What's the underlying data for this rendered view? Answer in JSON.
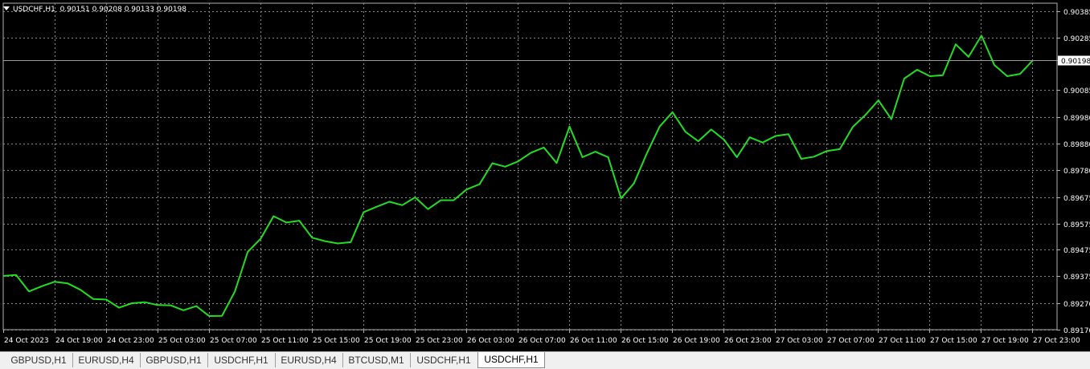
{
  "header": {
    "symbol": "USDCHF,H1",
    "ohlc": "0.90151 0.90208 0.90133 0.90198"
  },
  "current_price": "0.90198",
  "colors": {
    "line": "#22dd22",
    "grid": "#8a8a8a",
    "background": "#000000",
    "axis_text": "#ffffff"
  },
  "tabs": [
    {
      "label": "GBPUSD,H1"
    },
    {
      "label": "EURUSD,H4"
    },
    {
      "label": "GBPUSD,H1"
    },
    {
      "label": "USDCHF,H1"
    },
    {
      "label": "EURUSD,H4"
    },
    {
      "label": "BTCUSD,M1"
    },
    {
      "label": "USDCHF,H1"
    },
    {
      "label": "USDCHF,H1",
      "active": true
    }
  ],
  "chart_data": {
    "type": "line",
    "title": "",
    "ylim": [
      0.8917,
      0.90385
    ],
    "grid": true,
    "y_ticks": [
      "0.90385",
      "0.90285",
      "0.90198",
      "0.90085",
      "0.89980",
      "0.89880",
      "0.89780",
      "0.89675",
      "0.89575",
      "0.89475",
      "0.89375",
      "0.89270",
      "0.89170"
    ],
    "x_ticks": [
      "24 Oct 2023",
      "24 Oct 19:00",
      "24 Oct 23:00",
      "25 Oct 03:00",
      "25 Oct 07:00",
      "25 Oct 11:00",
      "25 Oct 15:00",
      "25 Oct 19:00",
      "25 Oct 23:00",
      "26 Oct 03:00",
      "26 Oct 07:00",
      "26 Oct 11:00",
      "26 Oct 15:00",
      "26 Oct 19:00",
      "26 Oct 23:00",
      "27 Oct 03:00",
      "27 Oct 07:00",
      "27 Oct 11:00",
      "27 Oct 15:00",
      "27 Oct 19:00",
      "27 Oct 23:00"
    ],
    "series": [
      {
        "values": [
          0.89375,
          0.89379,
          0.89316,
          0.89336,
          0.89353,
          0.89347,
          0.89322,
          0.89287,
          0.89285,
          0.89254,
          0.89271,
          0.89275,
          0.89264,
          0.89263,
          0.89244,
          0.8926,
          0.89222,
          0.89223,
          0.89316,
          0.89467,
          0.89517,
          0.89603,
          0.89579,
          0.89586,
          0.89521,
          0.89508,
          0.89499,
          0.89504,
          0.89618,
          0.89639,
          0.89658,
          0.89645,
          0.89675,
          0.8963,
          0.89664,
          0.89664,
          0.89705,
          0.89725,
          0.89805,
          0.89792,
          0.89812,
          0.89845,
          0.89865,
          0.89806,
          0.89945,
          0.89828,
          0.89849,
          0.89828,
          0.89671,
          0.89728,
          0.89842,
          0.89945,
          0.9,
          0.89925,
          0.89889,
          0.89934,
          0.89895,
          0.89828,
          0.89904,
          0.89884,
          0.89909,
          0.89916,
          0.89822,
          0.8983,
          0.89852,
          0.89859,
          0.89943,
          0.8999,
          0.90045,
          0.89973,
          0.90128,
          0.90162,
          0.90137,
          0.90141,
          0.90259,
          0.90211,
          0.90292,
          0.9018,
          0.90137,
          0.90146,
          0.90198
        ]
      }
    ]
  }
}
